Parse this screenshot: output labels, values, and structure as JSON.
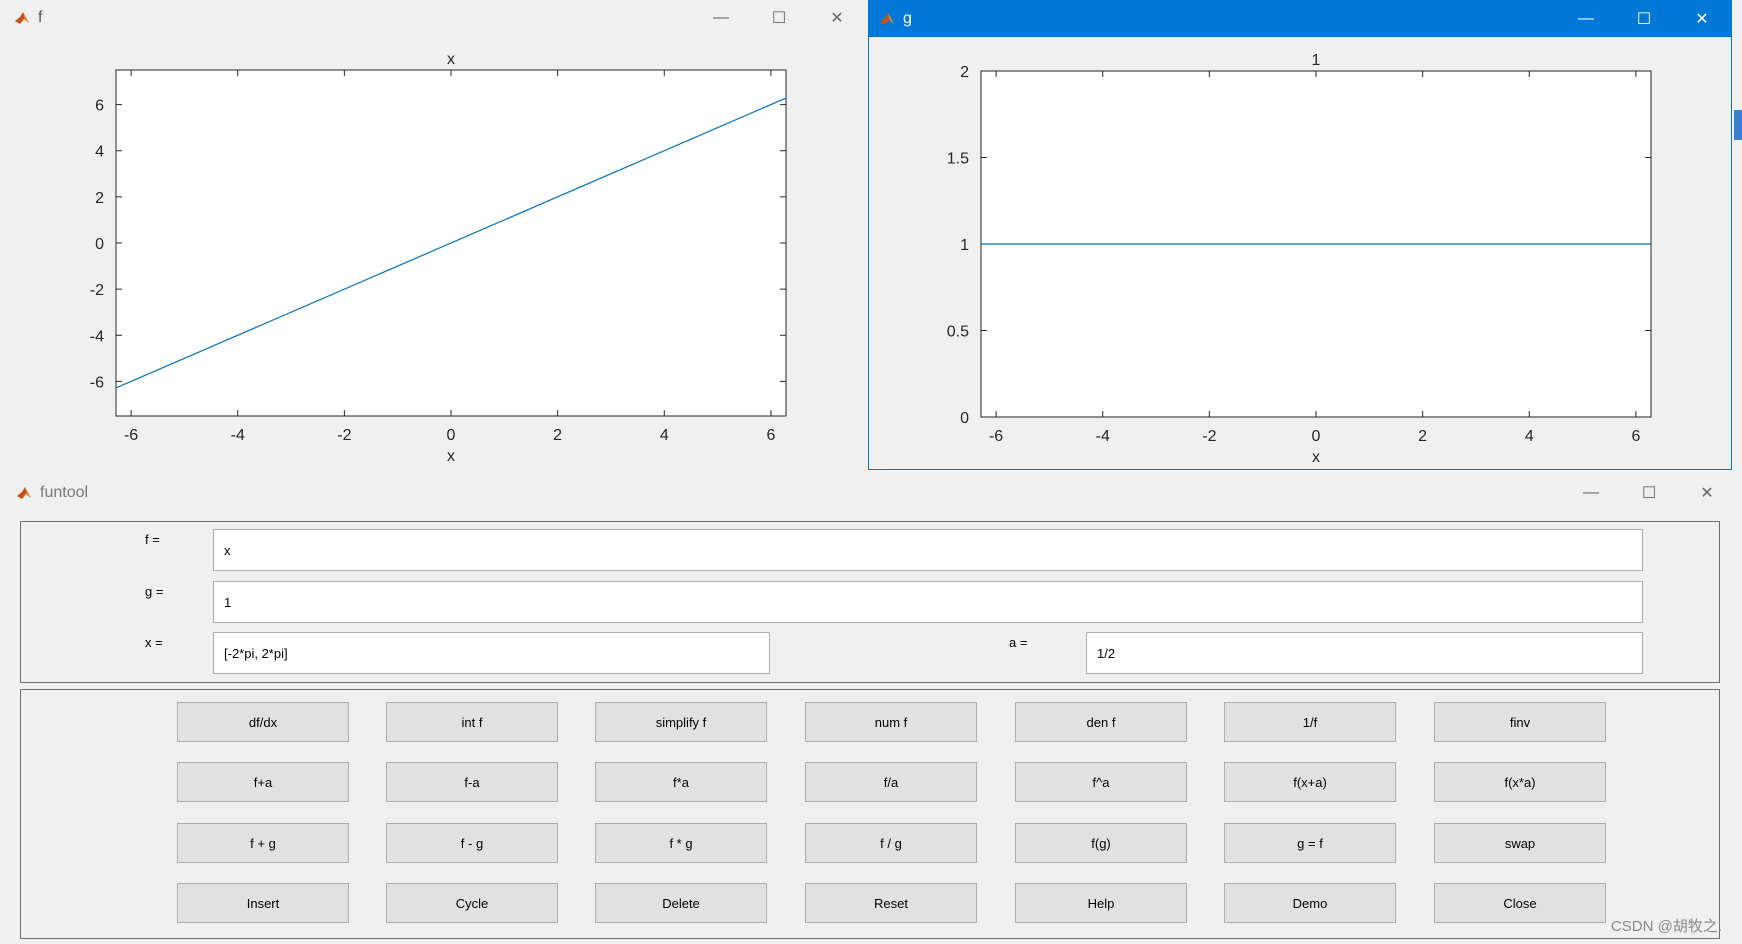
{
  "win_f": {
    "title": "f",
    "controls": {
      "min": "—",
      "max": "☐",
      "close": "✕"
    }
  },
  "win_g": {
    "title": "g",
    "controls": {
      "min": "—",
      "max": "☐",
      "close": "✕"
    }
  },
  "funtool": {
    "title": "funtool",
    "controls": {
      "min": "—",
      "max": "☐",
      "close": "✕"
    },
    "fields": {
      "f_label": "f =",
      "f_value": "x",
      "g_label": "g =",
      "g_value": "1",
      "x_label": "x =",
      "x_value": "[-2*pi, 2*pi]",
      "a_label": "a =",
      "a_value": "1/2"
    },
    "buttons": [
      [
        "df/dx",
        "int f",
        "simplify f",
        "num f",
        "den f",
        "1/f",
        "finv"
      ],
      [
        "f+a",
        "f-a",
        "f*a",
        "f/a",
        "f^a",
        "f(x+a)",
        "f(x*a)"
      ],
      [
        "f + g",
        "f - g",
        "f * g",
        "f / g",
        "f(g)",
        "g = f",
        "swap"
      ],
      [
        "Insert",
        "Cycle",
        "Delete",
        "Reset",
        "Help",
        "Demo",
        "Close"
      ]
    ]
  },
  "watermark": "CSDN @胡牧之.",
  "colors": {
    "line": "#0072bd",
    "titlebar_active": "#0078d7"
  },
  "chart_data": [
    {
      "type": "line",
      "title": "x",
      "xlabel": "x",
      "ylabel": "",
      "xlim": [
        -6.2832,
        6.2832
      ],
      "ylim": [
        -7.5,
        7.5
      ],
      "xticks": [
        -6,
        -4,
        -2,
        0,
        2,
        4,
        6
      ],
      "yticks": [
        -6,
        -4,
        -2,
        0,
        2,
        4,
        6
      ],
      "series": [
        {
          "x": [
            -6.2832,
            6.2832
          ],
          "y": [
            -6.2832,
            6.2832
          ]
        }
      ]
    },
    {
      "type": "line",
      "title": "1",
      "xlabel": "x",
      "ylabel": "",
      "xlim": [
        -6.2832,
        6.2832
      ],
      "ylim": [
        0,
        2
      ],
      "xticks": [
        -6,
        -4,
        -2,
        0,
        2,
        4,
        6
      ],
      "yticks": [
        0,
        0.5,
        1,
        1.5,
        2
      ],
      "series": [
        {
          "x": [
            -6.2832,
            6.2832
          ],
          "y": [
            1,
            1
          ]
        }
      ]
    }
  ]
}
